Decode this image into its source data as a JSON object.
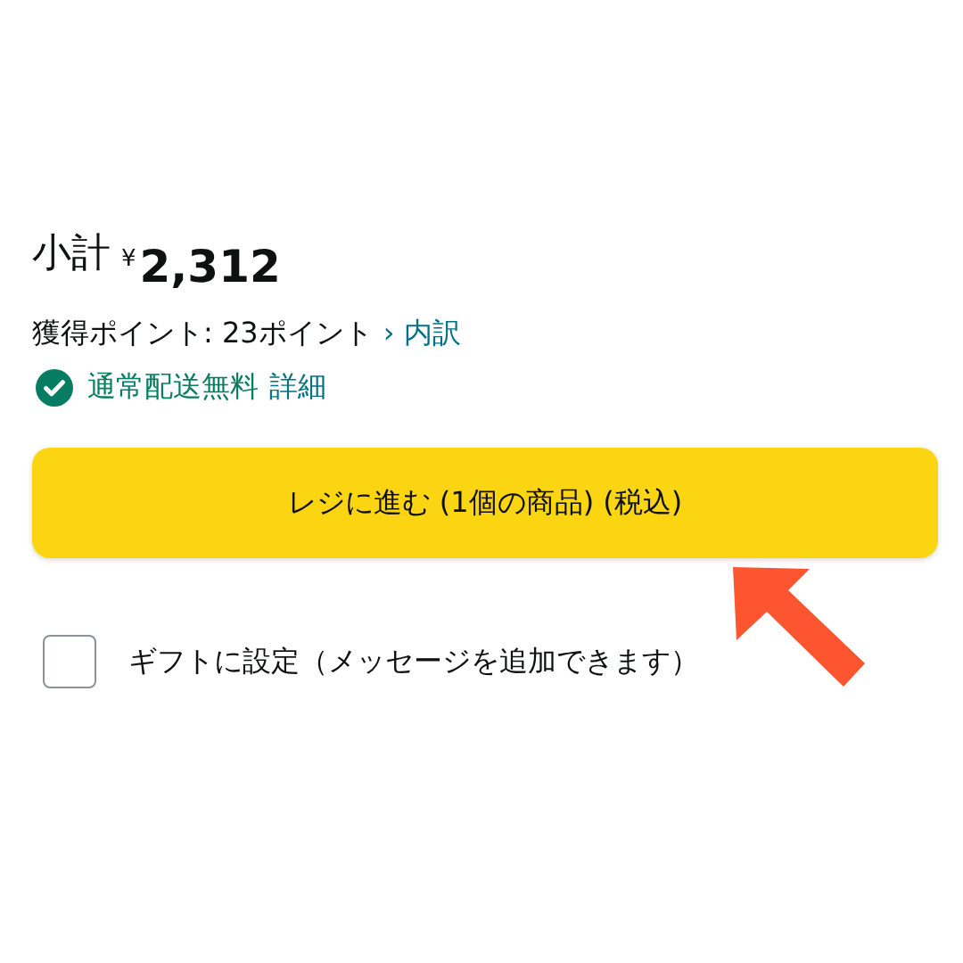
{
  "subtotal": {
    "label": "小計",
    "currency": "¥",
    "amount": "2,312"
  },
  "points": {
    "text": "獲得ポイント: 23ポイント",
    "link_arrow": "›",
    "link": "内訳"
  },
  "shipping": {
    "text": "通常配送無料",
    "link": "詳細"
  },
  "checkout_button": {
    "label": "レジに進む (1個の商品) (税込)"
  },
  "gift_option": {
    "label": "ギフトに設定（メッセージを追加できます）",
    "checked": false
  }
}
